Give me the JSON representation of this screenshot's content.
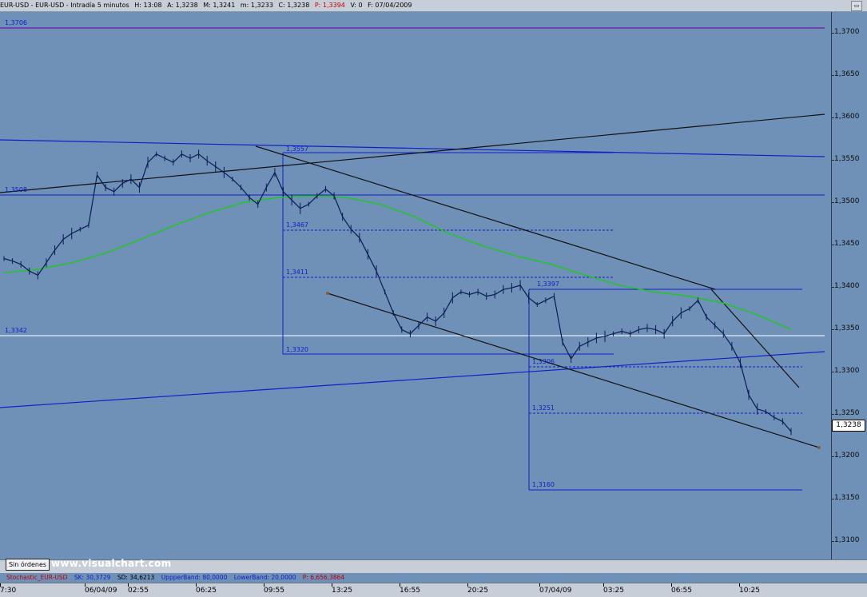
{
  "titlebar": {
    "symbol": "EUR-USD - EUR-USD - Intradía 5 minutos",
    "high": "H: 13:08",
    "ask": "A: 1,3238",
    "medium": "M: 1,3241",
    "min": "m: 1,3233",
    "close": "C: 1,3238",
    "p": "P: 1,3394",
    "v": "V: 0",
    "f": "F: 07/04/2009"
  },
  "price_axis": {
    "labels": [
      "1,3700",
      "1,3650",
      "1,3600",
      "1,3550",
      "1,3500",
      "1,3450",
      "1,3400",
      "1,3350",
      "1,3300",
      "1,3250",
      "1,3200",
      "1,3150",
      "1,3100"
    ],
    "current": "1,3238"
  },
  "levels": {
    "l1": "1,3706",
    "l2": "1,3508",
    "l3": "1,3342",
    "l4": "1,3557",
    "l5": "1,3467",
    "l6": "1,3411",
    "l7": "1,3320",
    "l8": "1,3397",
    "l9": "1,3306",
    "l10": "1,3251",
    "l11": "1,3160"
  },
  "time_axis": [
    "7:30",
    "06/04/09",
    "02:55",
    "06:25",
    "09:55",
    "13:25",
    "16:55",
    "20:25",
    "07/04/09",
    "03:25",
    "06:55",
    "10:25"
  ],
  "orders_button": "Sin órdenes",
  "watermark": "www.visualchart.com",
  "stochastic": {
    "name": "Stochastic_EUR-USD",
    "sk": "SK: 30,3729",
    "sd": "SD: 34,6213",
    "upper": "UppperBand: 80,0000",
    "lower": "LowerBand: 20,0000",
    "p": "P: 6,656,3864"
  },
  "chart_data": {
    "type": "line",
    "title": "EUR-USD - EUR-USD - Intradía 5 minutos",
    "ylim": [
      1.3085,
      1.374
    ],
    "yticks": [
      1.37,
      1.365,
      1.36,
      1.355,
      1.35,
      1.345,
      1.34,
      1.335,
      1.33,
      1.325,
      1.32,
      1.315,
      1.31
    ],
    "x_tick_labels": [
      "7:30",
      "06/04/09",
      "02:55",
      "06:25",
      "09:55",
      "13:25",
      "16:55",
      "20:25",
      "07/04/09",
      "03:25",
      "06:55",
      "10:25"
    ],
    "series": [
      {
        "name": "EUR-USD",
        "color": "#0a1a55",
        "values": [
          1.3445,
          1.3442,
          1.3438,
          1.343,
          1.3425,
          1.344,
          1.3455,
          1.3468,
          1.3475,
          1.348,
          1.3485,
          1.3545,
          1.353,
          1.3525,
          1.3535,
          1.354,
          1.353,
          1.356,
          1.357,
          1.3565,
          1.356,
          1.357,
          1.3565,
          1.357,
          1.3562,
          1.3555,
          1.3548,
          1.354,
          1.353,
          1.3518,
          1.351,
          1.353,
          1.3548,
          1.3525,
          1.3515,
          1.3505,
          1.351,
          1.352,
          1.3528,
          1.352,
          1.3495,
          1.348,
          1.347,
          1.345,
          1.343,
          1.3405,
          1.338,
          1.336,
          1.3355,
          1.3365,
          1.3375,
          1.337,
          1.338,
          1.3398,
          1.3405,
          1.3402,
          1.3405,
          1.34,
          1.3402,
          1.3408,
          1.341,
          1.3413,
          1.3398,
          1.339,
          1.3395,
          1.34,
          1.3345,
          1.3325,
          1.334,
          1.3345,
          1.335,
          1.3352,
          1.3355,
          1.3358,
          1.3355,
          1.336,
          1.3362,
          1.336,
          1.3355,
          1.337,
          1.338,
          1.3385,
          1.3395,
          1.3375,
          1.3365,
          1.3355,
          1.334,
          1.332,
          1.3282,
          1.3265,
          1.3262,
          1.3255,
          1.325,
          1.3238
        ]
      },
      {
        "name": "MA",
        "color": "#1fc81f",
        "values": [
          1.3428,
          1.3432,
          1.344,
          1.3452,
          1.3468,
          1.3485,
          1.35,
          1.3512,
          1.3518,
          1.352,
          1.3518,
          1.351,
          1.3495,
          1.3475,
          1.346,
          1.3448,
          1.3438,
          1.3425,
          1.3413,
          1.3405,
          1.34,
          1.3392,
          1.3378,
          1.336
        ]
      }
    ],
    "annotations": [
      "1,3706",
      "1,3508",
      "1,3342",
      "1,3557",
      "1,3467",
      "1,3411",
      "1,3320",
      "1,3397",
      "1,3306",
      "1,3251",
      "1,3160"
    ]
  }
}
